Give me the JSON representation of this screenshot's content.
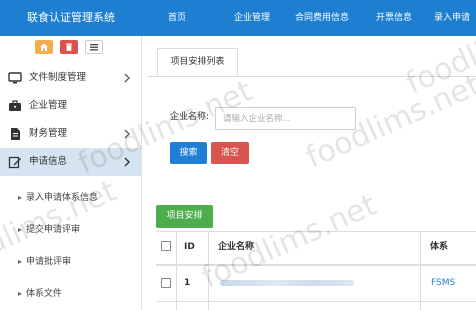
{
  "header": {
    "app_title": "联食认证管理系统",
    "nav": [
      "首页",
      "企业管理",
      "合同费用信息",
      "开票信息",
      "录入申请"
    ]
  },
  "sidebar": {
    "items": [
      {
        "label": "文件制度管理",
        "icon": "monitor-icon",
        "chevron": true
      },
      {
        "label": "企业管理",
        "icon": "briefcase-icon",
        "chevron": false
      },
      {
        "label": "财务管理",
        "icon": "document-icon",
        "chevron": true
      },
      {
        "label": "申请信息",
        "icon": "edit-icon",
        "chevron": true,
        "active": true
      }
    ],
    "sub_items": [
      "录入申请体系信息",
      "提交申请评审",
      "申请批评审",
      "体系文件"
    ]
  },
  "main": {
    "tab_label": "项目安排列表",
    "search": {
      "label": "企业名称:",
      "placeholder": "请输入企业名称...",
      "value": "",
      "search_button": "搜索",
      "clear_button": "清空"
    },
    "arrange_button": "项目安排",
    "table": {
      "columns": [
        "ID",
        "企业名称",
        "体系"
      ],
      "rows": [
        {
          "id": "1",
          "company": "",
          "system": "FSMS"
        }
      ]
    }
  },
  "watermark": "foodlims.net",
  "colors": {
    "header_bg": "#1e7fd1",
    "active_menu_bg": "#d6e4f1",
    "primary": "#1f7fd6",
    "danger": "#d9534f",
    "success": "#4cae4c",
    "tool_orange": "#f0ad4e",
    "tool_red": "#d9534f",
    "link": "#1f7fd6"
  }
}
